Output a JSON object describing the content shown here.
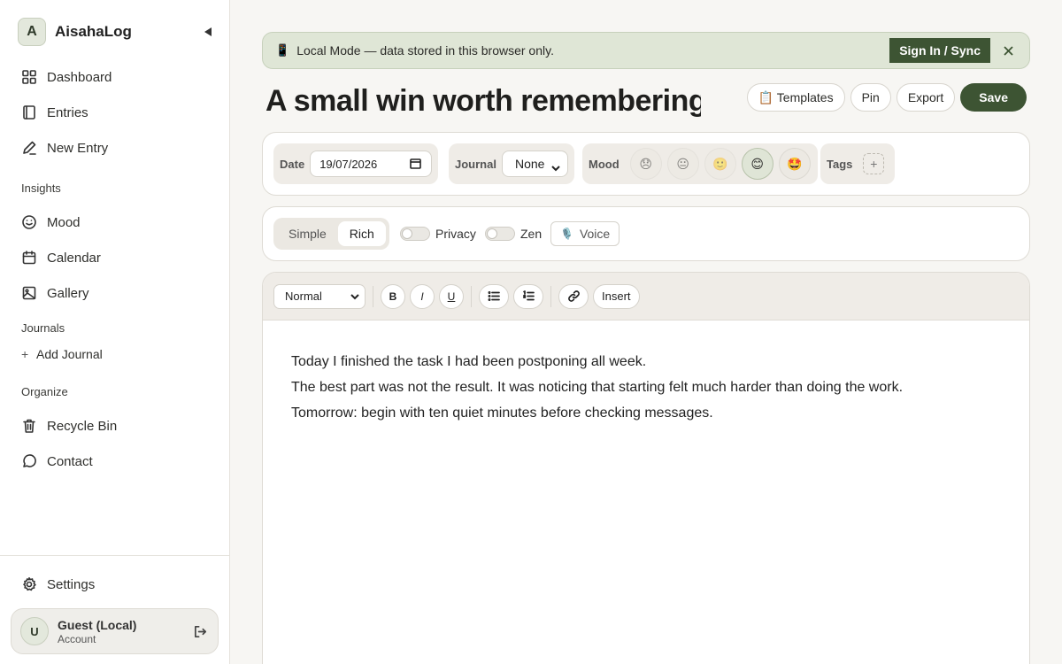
{
  "app": {
    "logo_letter": "A",
    "name": "AisahaLog"
  },
  "sidebar": {
    "items": [
      {
        "label": "Dashboard"
      },
      {
        "label": "Entries"
      },
      {
        "label": "New Entry"
      }
    ],
    "insights_label": "Insights",
    "insights": [
      {
        "label": "Mood"
      },
      {
        "label": "Calendar"
      },
      {
        "label": "Gallery"
      }
    ],
    "journals_label": "Journals",
    "add_journal": "Add Journal",
    "organize_label": "Organize",
    "organize": [
      {
        "label": "Recycle Bin"
      },
      {
        "label": "Contact"
      }
    ],
    "settings": "Settings",
    "account": {
      "initial": "U",
      "name": "Guest (Local)",
      "sub": "Account"
    }
  },
  "banner": {
    "icon": "📱",
    "message": "Local Mode — data stored in this browser only.",
    "sign_in": "Sign In / Sync"
  },
  "entry": {
    "title": "A small win worth remembering",
    "actions": {
      "templates": "📋 Templates",
      "pin": "Pin",
      "export": "Export",
      "save": "Save"
    },
    "meta": {
      "date_label": "Date",
      "date_value": "19/07/2026",
      "journal_label": "Journal",
      "journal_value": "None",
      "mood_label": "Mood",
      "moods": [
        "😞",
        "😐",
        "🙂",
        "😊",
        "🤩"
      ],
      "selected_mood_index": 3,
      "tags_label": "Tags",
      "tags_add": "+"
    },
    "mode": {
      "options": [
        "Simple",
        "Rich"
      ],
      "active": "Rich",
      "privacy": "Privacy",
      "zen": "Zen",
      "voice": "Voice",
      "voice_icon": "🎙️"
    },
    "toolbar": {
      "format": "Normal",
      "bold": "B",
      "italic": "I",
      "underline": "U",
      "insert": "Insert"
    },
    "body": [
      "Today I finished the task I had been postponing all week.",
      "The best part was not the result. It was noticing that starting felt much harder than doing the work.",
      "Tomorrow: begin with ten quiet minutes before checking messages."
    ]
  },
  "colors": {
    "accent": "#3d5433",
    "banner_bg": "#dfe6d6"
  }
}
